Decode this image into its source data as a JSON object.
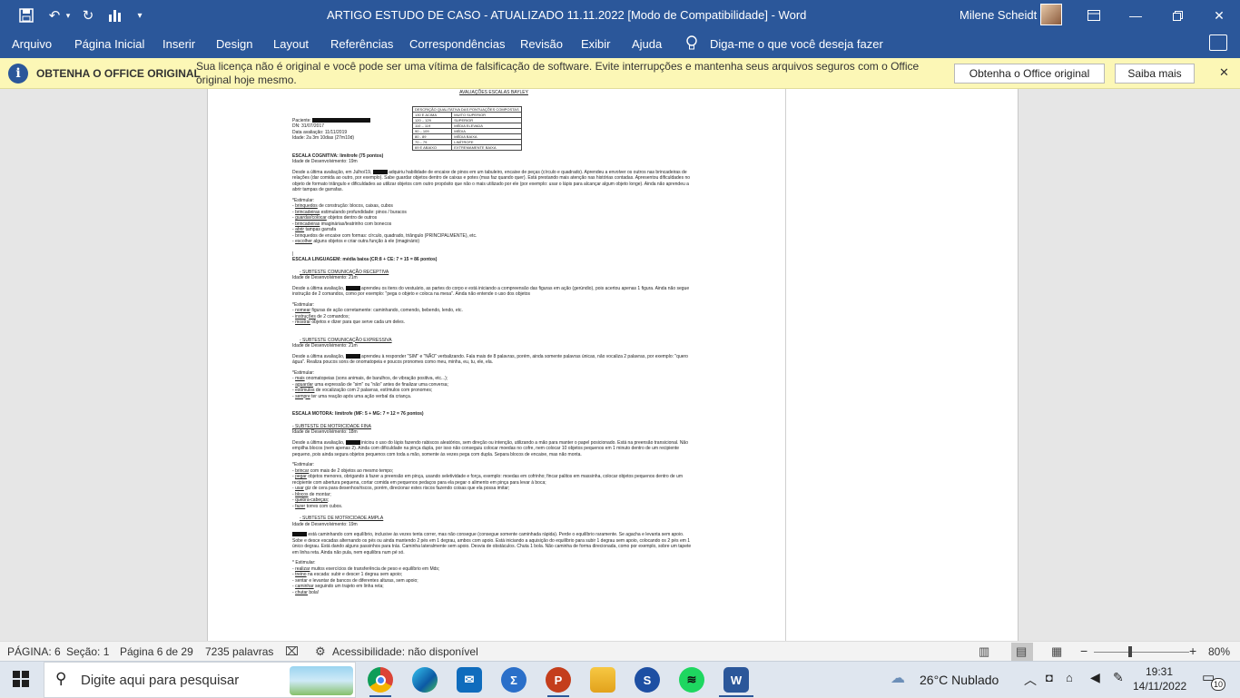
{
  "window": {
    "title": "ARTIGO ESTUDO DE CASO - ATUALIZADO 11.11.2022 [Modo de Compatibilidade]  -  Word",
    "user": "Milene Scheidt",
    "quick_access": [
      "save-icon",
      "undo-icon",
      "redo-icon",
      "chart-icon",
      "dropdown-icon"
    ],
    "controls": [
      "ribbon-display-icon",
      "minimize-icon",
      "restore-icon",
      "close-icon"
    ]
  },
  "menu": {
    "items": [
      "Arquivo",
      "Página Inicial",
      "Inserir",
      "Design",
      "Layout",
      "Referências",
      "Correspondências",
      "Revisão",
      "Exibir",
      "Ajuda"
    ],
    "tell_me": "Diga-me o que você deseja fazer"
  },
  "banner": {
    "title": "OBTENHA O OFFICE ORIGINAL",
    "message": "Sua licença não é original e você pode ser uma vítima de falsificação de software. Evite interrupções e mantenha seus arquivos seguros com o Office original hoje mesmo.",
    "button_primary": "Obtenha o Office original",
    "button_secondary": "Saiba mais"
  },
  "doc": {
    "header": "AVALIAÇÕES ESCALAS BAYLEY",
    "table": [
      [
        "DESCRIÇÃO QUALITATIVA DAS PONTUAÇÕES COMPOSTAS",
        ""
      ],
      [
        "130 E ACIMA",
        "MUITO SUPERIOR"
      ],
      [
        "120 – 129",
        "SUPERIOR"
      ],
      [
        "110 – 119",
        "MÉDIA ELEVADA"
      ],
      [
        "90 – 109",
        "MÉDIA"
      ],
      [
        "80 - 89",
        "MÉDIA BAIXA"
      ],
      [
        "70 – 79",
        "LIMÍTROFE"
      ],
      [
        "69 E ABAIXO",
        "EXTREMAMENTE BAIXA"
      ]
    ],
    "patient_label": "Paciente:",
    "dn": "DN: 31/07/2017",
    "eval_date": "Data avaliação: 11/11/2019",
    "age": "Idade: 2a 3m 10dias (27m10d)",
    "cog_title": "ESCALA COGNITIVA:  limítrofe (75 pontos)",
    "cog_dev": "Idade de Desenvolvimento: 19m",
    "cog_para_a": "Desde a última avaliação, em Julho/19,",
    "cog_para_b": "adquiriu habilidade de encaixe de pinos em um tabuleiro, encaixe de peças (círculo e quadrado). Aprendeu a envolver os outros nas brincadeiras de relações (dar comida ao outro, por exemplo). Sabe guardar objetos dentro de caixas e potes (mas faz quando quer). Está prestando mais atenção nas histórias contadas.  Apresentou dificuldades no objeto de formato triângulo e dificuldades ao utilizar objetos com outro propósito que não o mais utilizado por ele (por exemplo: usar o lápis para alcançar algum objeto longe). Ainda não aprendeu a abrir tampas de garrafas.",
    "cog_stim": "*Estimular:",
    "cog_list": [
      [
        "brinquedos",
        " de construção: blocos, caixas, cubos"
      ],
      [
        "brincadeiras",
        " estimulando profundidade: pinos / buracos"
      ],
      [
        "guardar/colocar",
        " objetos dentro de outros"
      ],
      [
        "brincadeiras",
        " imaginárias/teatrinho com bonecos"
      ],
      [
        "abrir",
        " tampas garrafa"
      ],
      [
        "",
        " brinquedos de encaixe com formas: círculo, quadrado, triângulo (PRINCIPALMENTE), etc."
      ],
      [
        "escolher",
        " alguns objetos e criar outra função à ele (imaginário)"
      ]
    ],
    "cursor": "|",
    "lang_title": "ESCALA LINGUAGEM: média baixa (CR:8 + CE: 7 = 15 = 86 pontos)",
    "rec_title": "- SUBTESTE COMUNICAÇÃO RECEPTIVA",
    "rec_dev": "Idade de Desenvolvimento: 21m",
    "rec_para_a": "Desde a última avaliação,",
    "rec_para_b": "aprendeu os itens do vestuário, as partes do corpo e está iniciando a compreensão das figuras em ação (gerúndio), pois acertou apenas 1 figura. Ainda não segue instrução de 2 comandos, como por exemplo: \"pega o objeto e coloca na mesa\". Ainda não entende o uso dos objetos",
    "rec_stim": "*Estimular:",
    "rec_list": [
      [
        "nomear",
        " figuras de ação corretamente: caminhando, comendo, bebendo, lendo, etc."
      ],
      [
        "instruções",
        " de 2 comandos;"
      ],
      [
        "mostrar",
        " objetos e dizer para que serve cada um deles."
      ]
    ],
    "exp_title": "- SUBTESTE COMUNICAÇÃO EXPRESSIVA",
    "exp_dev": "Idade de Desenvolvimento: 21m",
    "exp_para_a": "Desde a última avaliação,",
    "exp_para_b": "aprendeu à responder \"SIM\" e \"NÃO\" verbalizando. Fala mais de 8 palavras, porém, ainda somente palavras únicas, não vocaliza 2 palavras, por exemplo: \"quero água\". Realiza poucos sons de onomatopeia e poucos pronomes como meu, minha, eu, tu, ele, ela.",
    "exp_stim": "*Estimular:",
    "exp_list": [
      [
        "mais",
        " onomatopeias (sons animais, de barulhos, de vibração positiva, etc...);"
      ],
      [
        "aguardar",
        " uma expressão de \"sim\" ou \"não\" antes de finalizar uma conversa;"
      ],
      [
        "estímulos",
        " de vocalização com 2 palavras, estímulos com pronomes;"
      ],
      [
        "sempre",
        " ter uma reação após uma ação verbal da criança."
      ]
    ],
    "mot_title": "ESCALA MOTORA: limítrofe (MF: 5 + MG: 7 = 12 = 76 pontos)",
    "fine_title": "- SUBTESTE DE MOTRICIDADE FINA",
    "fine_dev": "Idade de Desenvolvimento: 18m",
    "fine_para_a": "Desde a última avaliação,",
    "fine_para_b": "iniciou o uso do lápis fazendo rabiscos aleatórios, sem direção ou intenção, utilizando a mão para manter o papel posicionado. Está na preensão transicional. Não empilha blocos (nem apenas 2). Ainda com dificuldade na pinça dupla, por isso não conseguiu colocar moedas no cofre, nem colocar 10 objetos pequenos em 1 minuto dentro de um recipiente pequeno, pois ainda segura objetos pequenos com toda a mão, somente às vezes pega com dupla. Separa blocos de encaixe, mas não monta.",
    "fine_stim": "*Estimular:",
    "fine_list": [
      [
        "brincar",
        " com mais de 2 objetos ao mesmo tempo;"
      ],
      [
        "pegar",
        " objetos menores, obrigando à fazer a preensão em pinça, usando seletividade e força, exemplo: moedas em cofrinho; fincar palitos em massinha, colocar objetos pequenos dentro de um recipiente com abertura pequena, cortar comida em pequenos pedaços para ela pegar o alimento em pinça para levar à boca;"
      ],
      [
        "usar",
        " giz de cera para desenhos/riscos, porém, direcionar estes riscos fazendo coisas que ela possa imitar;"
      ],
      [
        "blocos",
        " de montar;"
      ],
      [
        "quebra-cabeças",
        ";"
      ],
      [
        "fazer",
        " torres com cubos."
      ]
    ],
    "gross_title": "- SUBTESTE DE MOTRICIDADE AMPLA",
    "gross_dev": "Idade de Desenvolvimento: 19m",
    "gross_para": "está caminhando com equilíbrio, inclusive às vezes tenta correr, mas não consegue (consegue somente caminhada rápida). Perde o equilíbrio raramente. Se agacha e levanta sem apoio. Sobe e desce escadas alternando os pés ou ainda mantendo 2 pés em 1 degrau, ambos com apoio. Está iniciando a aquisição do equilíbrio para subir 1 degrau sem apoio, colocando os 2 pés em 1 único degrau. Está dando alguns passinhos para trás. Caminha lateralmente sem apoio. Desvia de obstáculos. Chuta 1 bola. Não caminha de forma direcionada, como por exemplo, sobre um tapete em linha reta. Ainda não pula, nem equilibra num pé só.",
    "gross_stim": "* Estimular:",
    "gross_list": [
      [
        "realizar",
        " muitos exercícios de transferência de peso e equilíbrio em Mds;"
      ],
      [
        "treino",
        " na escada: subir e descer 1 degrau sem apoio;"
      ],
      [
        "",
        " sentar e levantar de bancos de diferentes alturas, sem apoio;"
      ],
      [
        "caminhar",
        " seguindo um trajeto em linha reta;"
      ],
      [
        "chutar",
        " bola!"
      ]
    ]
  },
  "status": {
    "page": "PÁGINA: 6",
    "section": "Seção: 1",
    "page_of": "Página 6 de 29",
    "words": "7235 palavras",
    "accessibility": "Acessibilidade: não disponível",
    "zoom": "80%",
    "zoom_level": 0.38
  },
  "taskbar": {
    "search_placeholder": "Digite aqui para pesquisar",
    "apps": [
      "chrome-icon",
      "edge-icon",
      "mail-icon",
      "math-icon",
      "powerpoint-icon",
      "file-explorer-icon",
      "skype-icon",
      "spotify-icon",
      "word-icon"
    ],
    "weather": "26°C  Nublado",
    "time": "19:31",
    "date": "14/11/2022",
    "notifications": "10"
  },
  "colors": {
    "accent": "#2b579a",
    "banner": "#fcf7b6"
  }
}
